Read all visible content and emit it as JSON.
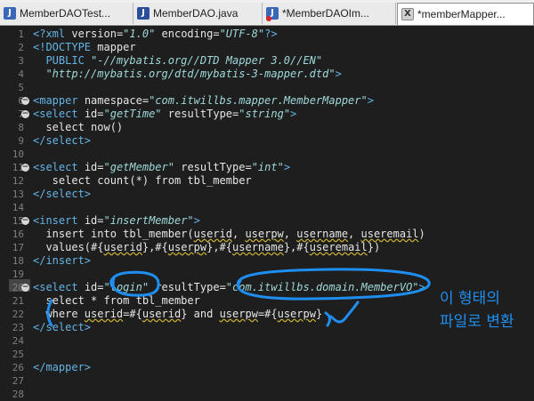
{
  "tabs": [
    {
      "label": "MemberDAOTest...",
      "icon": "java-class-icon",
      "active": false
    },
    {
      "label": "MemberDAO.java",
      "icon": "java-interface-icon",
      "active": false
    },
    {
      "label": "*MemberDAOIm...",
      "icon": "java-class-error-icon",
      "active": false
    },
    {
      "label": "*memberMapper...",
      "icon": "xml-file-icon",
      "active": true
    }
  ],
  "code_lines": [
    {
      "n": "1",
      "text": "<?xml version=\"1.0\" encoding=\"UTF-8\"?>"
    },
    {
      "n": "2",
      "text": "<!DOCTYPE mapper"
    },
    {
      "n": "3",
      "text": "  PUBLIC \"-//mybatis.org//DTD Mapper 3.0//EN\""
    },
    {
      "n": "4",
      "text": "  \"http://mybatis.org/dtd/mybatis-3-mapper.dtd\">"
    },
    {
      "n": "5",
      "text": ""
    },
    {
      "n": "6",
      "text": "<mapper namespace=\"com.itwillbs.mapper.MemberMapper\">",
      "fold": true
    },
    {
      "n": "7",
      "text": "<select id=\"getTime\" resultType=\"string\">",
      "fold": true
    },
    {
      "n": "8",
      "text": "  select now()"
    },
    {
      "n": "9",
      "text": "</select>"
    },
    {
      "n": "10",
      "text": ""
    },
    {
      "n": "11",
      "text": "<select id=\"getMember\" resultType=\"int\">",
      "fold": true
    },
    {
      "n": "12",
      "text": "   select count(*) from tbl_member"
    },
    {
      "n": "13",
      "text": "</select>"
    },
    {
      "n": "14",
      "text": ""
    },
    {
      "n": "15",
      "text": "<insert id=\"insertMember\">",
      "fold": true
    },
    {
      "n": "16",
      "text": "  insert into tbl_member(userid, userpw, username, useremail)"
    },
    {
      "n": "17",
      "text": "  values(#{userid},#{userpw},#{username},#{useremail})"
    },
    {
      "n": "18",
      "text": "</insert>"
    },
    {
      "n": "19",
      "text": ""
    },
    {
      "n": "20",
      "text": "<select id=\"login\" resultType=\"com.itwillbs.domain.MemberVO\">",
      "fold": true
    },
    {
      "n": "21",
      "text": "  select * from tbl_member"
    },
    {
      "n": "22",
      "text": "  where userid=#{userid} and userpw=#{userpw}"
    },
    {
      "n": "23",
      "text": "</select>"
    },
    {
      "n": "24",
      "text": ""
    },
    {
      "n": "25",
      "text": ""
    },
    {
      "n": "26",
      "text": "</mapper>"
    },
    {
      "n": "27",
      "text": ""
    },
    {
      "n": "28",
      "text": ""
    }
  ],
  "annotation": {
    "line1": "이 형태의",
    "line2": "파일로 변환"
  },
  "colors": {
    "background": "#1e1e1e",
    "tag": "#64b4e6",
    "attribute_value": "#9fd8d8",
    "annotation_ink": "#1e8ff0"
  }
}
